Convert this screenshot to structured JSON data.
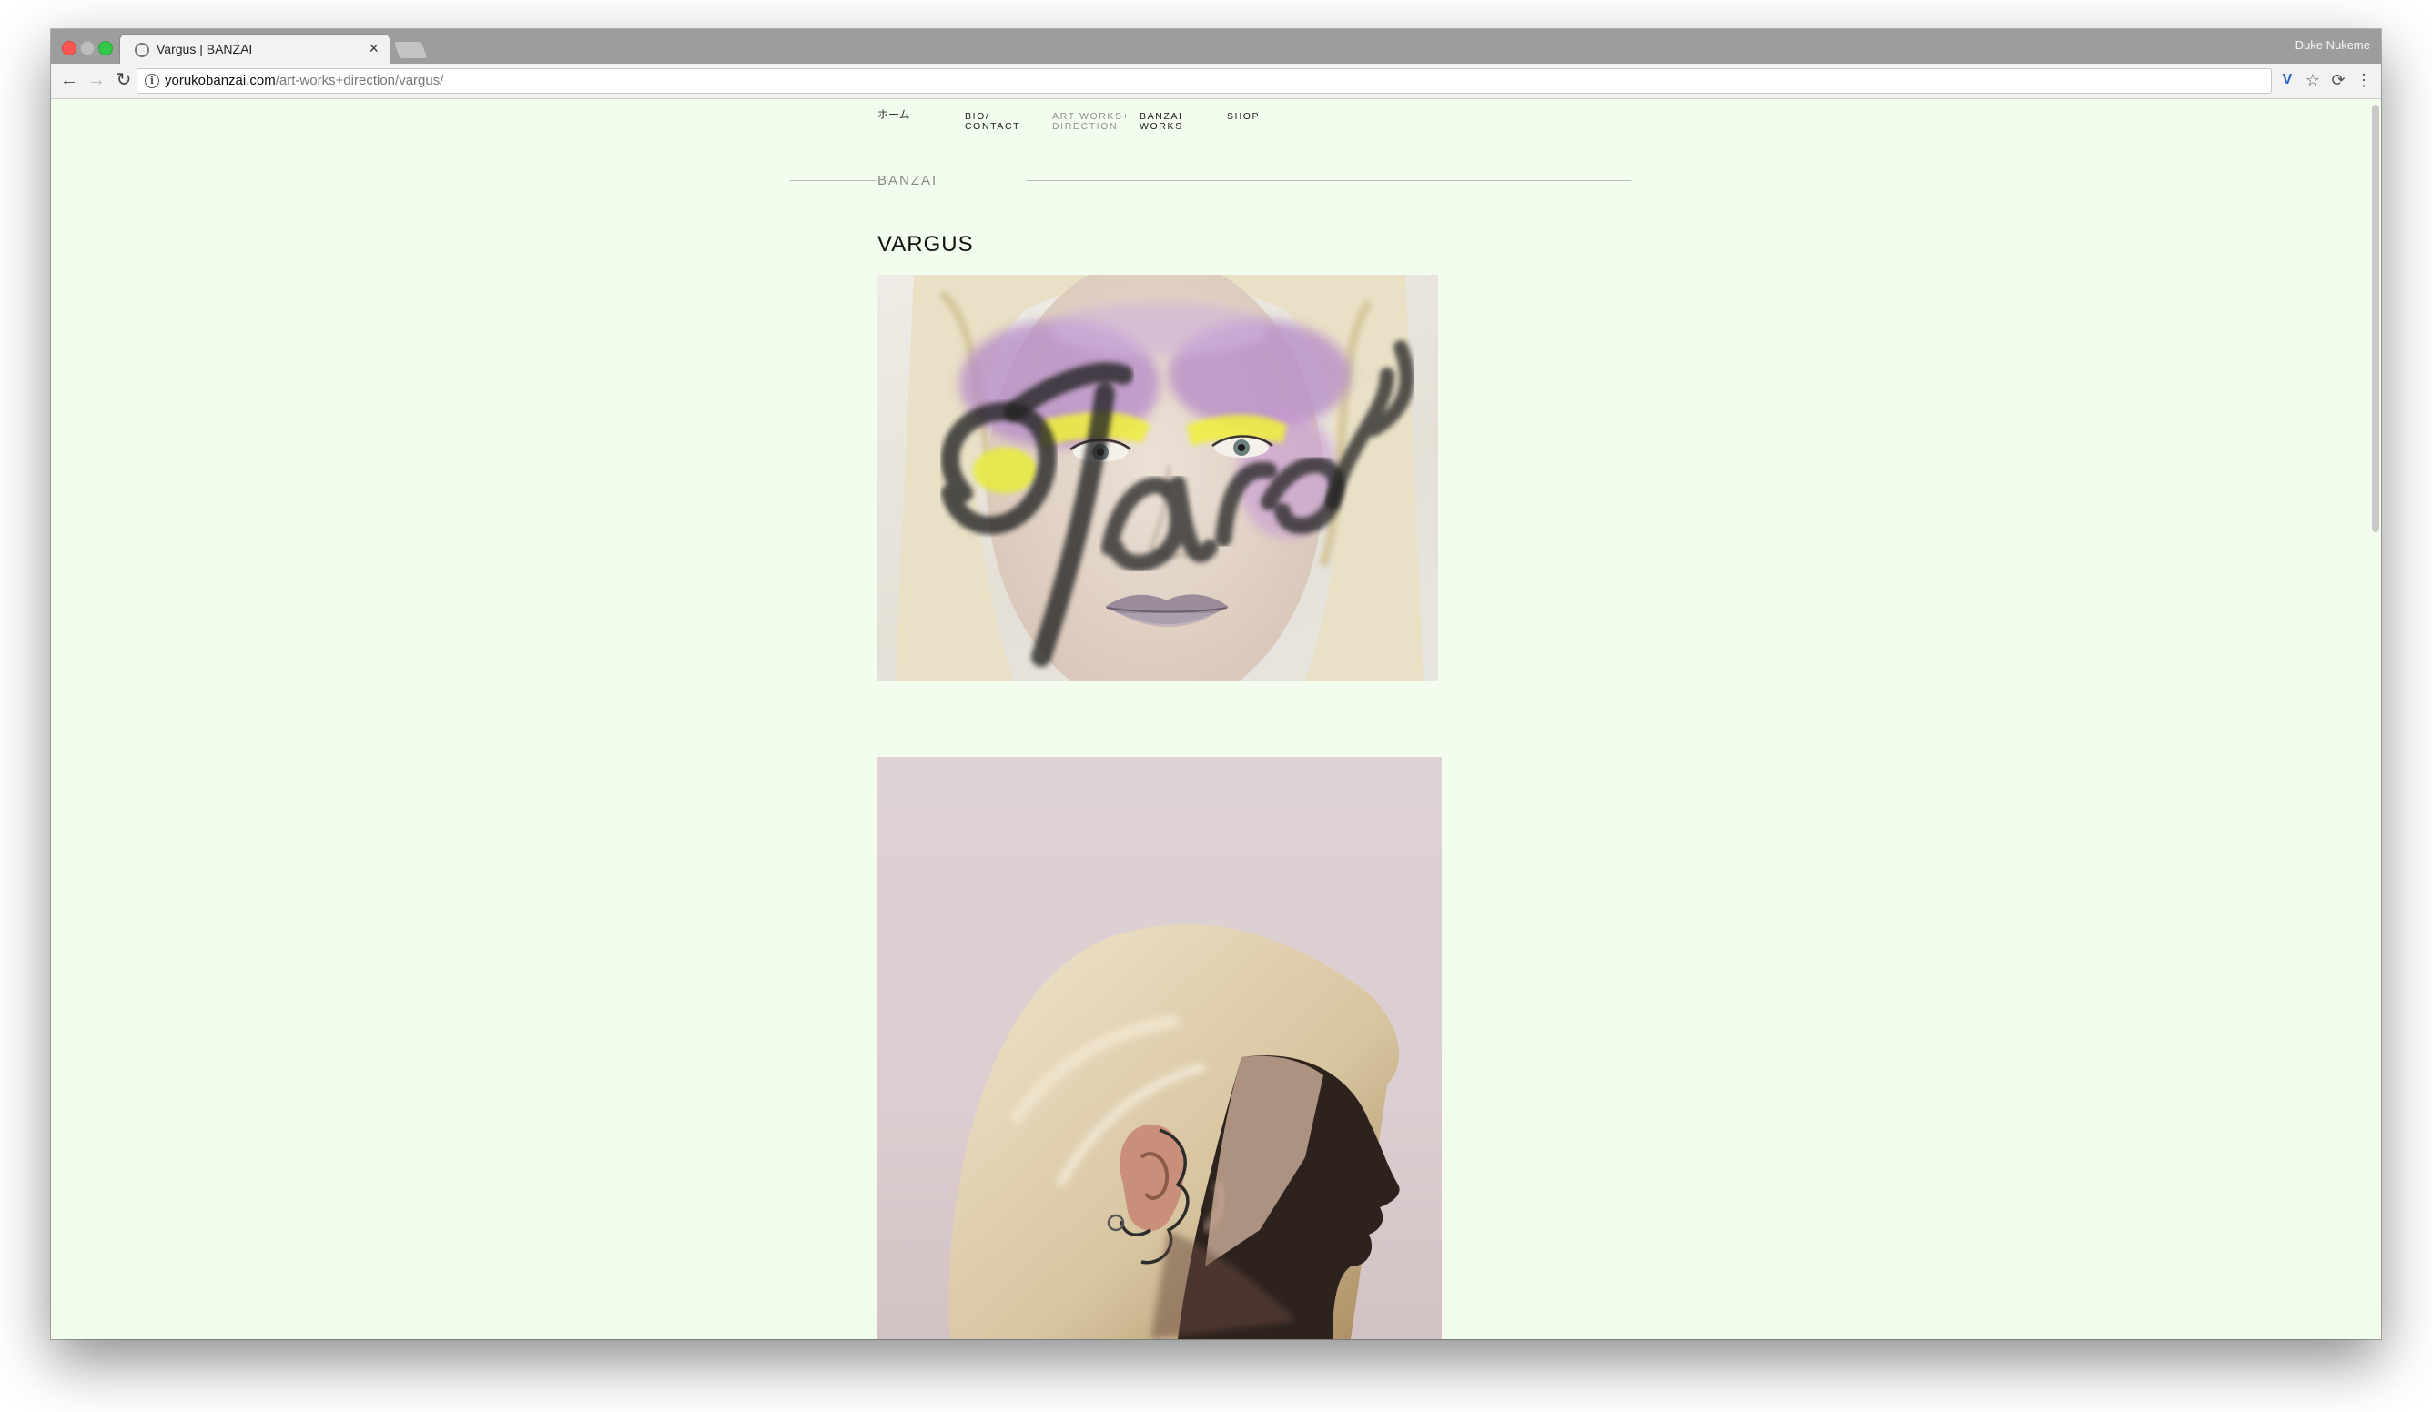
{
  "browser": {
    "tab_title": "Vargus | BANZAI",
    "tab_close": "×",
    "profile_name": "Duke Nukeme",
    "url_host": "yorukobanzai.com",
    "url_path": "/art-works+direction/vargus/",
    "icons": {
      "back": "back-arrow-icon",
      "forward": "forward-arrow-icon",
      "reload": "reload-icon",
      "info": "info-icon",
      "extension": "vivaldi-extension-icon",
      "bookmark": "star-icon",
      "sync": "sync-icon",
      "menu": "kebab-menu-icon"
    }
  },
  "site": {
    "nav": {
      "home": "ホーム",
      "bio": "BIO/\nCONTACT",
      "art": "ART WORKS+\nDIRECTION",
      "banzai": "BANZAI\nWORKS",
      "shop": "SHOP"
    },
    "section_label": "BANZAI",
    "post_title": "VARGUS",
    "photo1_overlay_text": "Vargus"
  },
  "colors": {
    "page_background": "#f3fdee",
    "nav_active_gray": "#8f8f8f",
    "chrome_tabstrip": "#9d9d9d"
  }
}
